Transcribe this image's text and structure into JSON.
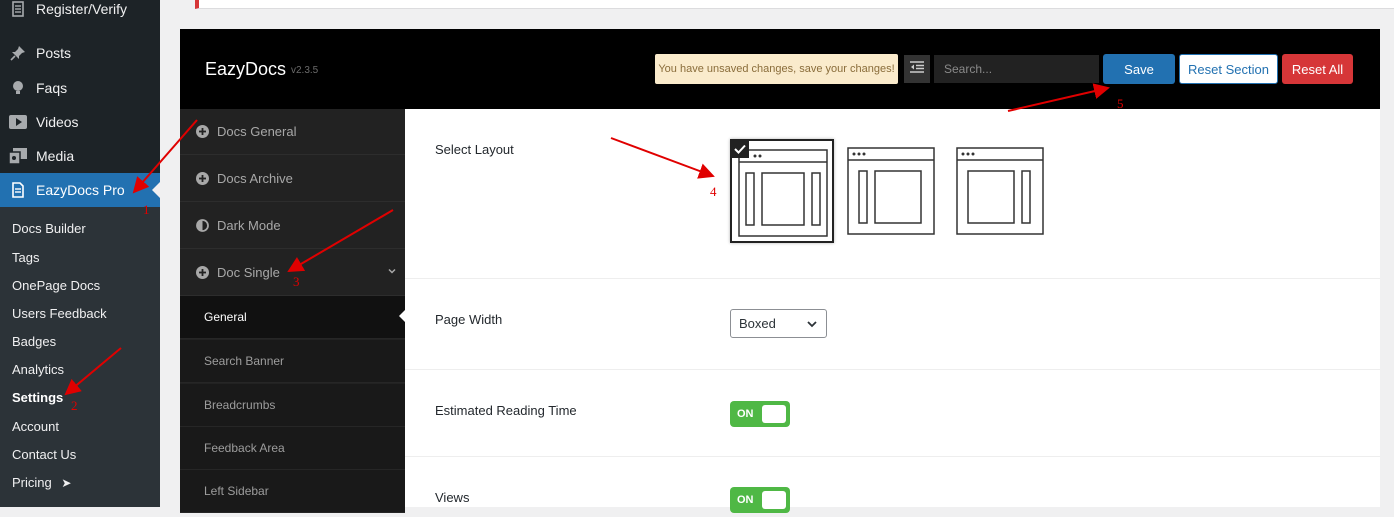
{
  "wp_menu": {
    "items": [
      {
        "label": "Register/Verify",
        "icon": "document-icon"
      },
      {
        "label": "Posts",
        "icon": "pin-icon"
      },
      {
        "label": "Faqs",
        "icon": "lightbulb-icon"
      },
      {
        "label": "Videos",
        "icon": "play-icon"
      },
      {
        "label": "Media",
        "icon": "media-icon"
      },
      {
        "label": "EazyDocs Pro",
        "icon": "page-icon"
      }
    ],
    "submenu": [
      "Docs Builder",
      "Tags",
      "OnePage Docs",
      "Users Feedback",
      "Badges",
      "Analytics",
      "Settings",
      "Account",
      "Contact Us",
      "Pricing"
    ],
    "submenu_current": "Settings",
    "pricing_arrow": "➤"
  },
  "header": {
    "title": "EazyDocs",
    "version": "v2.3.5",
    "unsaved_notice": "You have unsaved changes, save your changes!",
    "search_placeholder": "Search...",
    "save_label": "Save",
    "reset_section_label": "Reset Section",
    "reset_all_label": "Reset All"
  },
  "panel_nav": {
    "sections": [
      {
        "label": "Docs General",
        "icon": "plus-circle-icon"
      },
      {
        "label": "Docs Archive",
        "icon": "plus-circle-icon"
      },
      {
        "label": "Dark Mode",
        "icon": "half-circle-icon"
      },
      {
        "label": "Doc Single",
        "icon": "plus-circle-icon"
      }
    ],
    "subitems": [
      "General",
      "Search Banner",
      "Breadcrumbs",
      "Feedback Area",
      "Left Sidebar"
    ],
    "subitem_current": "General"
  },
  "content": {
    "select_layout_label": "Select Layout",
    "page_width_label": "Page Width",
    "page_width_value": "Boxed",
    "reading_time_label": "Estimated Reading Time",
    "reading_time_toggle": "ON",
    "views_label": "Views",
    "views_toggle": "ON"
  },
  "annotations": [
    "1",
    "2",
    "3",
    "4",
    "5"
  ],
  "colors": {
    "wp_sidebar": "#1d2327",
    "wp_active": "#2271b1",
    "panel_header": "#000000",
    "toggle_on": "#4fb845",
    "reset_all": "#d63638",
    "annotation": "#e00000"
  }
}
